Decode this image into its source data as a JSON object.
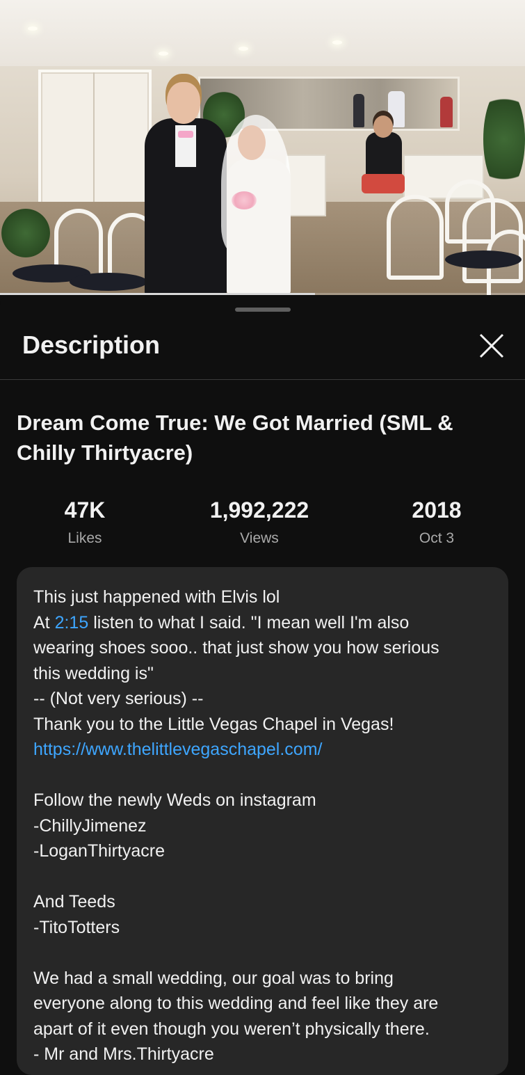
{
  "video": {
    "progress_fraction": 0.6
  },
  "sheet": {
    "header_title": "Description",
    "close_icon": "close-icon",
    "video_title": "Dream Come True: We Got Married (SML & Chilly Thirtyacre)",
    "stats": [
      {
        "value": "47K",
        "label": "Likes"
      },
      {
        "value": "1,992,222",
        "label": "Views"
      },
      {
        "value": "2018",
        "label": "Oct 3"
      }
    ],
    "description": {
      "line1": "This just happened with Elvis lol",
      "line2_prefix": "At ",
      "line2_timestamp": "2:15",
      "line2_suffix": " listen to what I said. \"I mean well I'm also",
      "line3": "wearing shoes sooo.. that just show you how serious",
      "line4": "this wedding is\"",
      "line5": "-- (Not very serious) --",
      "line6": "Thank you to the Little Vegas Chapel in Vegas!",
      "link": "https://www.thelittlevegaschapel.com/",
      "line8": "Follow the newly Weds on instagram",
      "line9": "-ChillyJimenez",
      "line10": "-LoganThirtyacre",
      "line12": "And Teeds",
      "line13": "-TitoTotters",
      "line15": "We had a small wedding, our goal was to bring",
      "line16": "everyone along to this wedding and feel like they are",
      "line17": "apart of it even though you weren’t physically there.",
      "line18": "- Mr and Mrs.Thirtyacre"
    }
  },
  "colors": {
    "background": "#0f0f0f",
    "card": "#272727",
    "link": "#3ea6ff",
    "secondary_text": "#aaaaaa"
  }
}
